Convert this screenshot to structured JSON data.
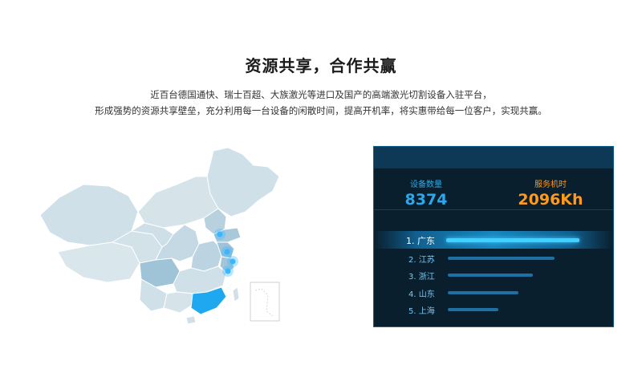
{
  "header": {
    "title": "资源共享，合作共赢",
    "desc_line1": "近百台德国通快、瑞士百超、大族激光等进口及国产的高端激光切割设备入驻平台，",
    "desc_line2": "形成强势的资源共享壁垒，充分利用每一台设备的闲散时间，提高开机率，将实惠带给每一位客户，实现共赢。"
  },
  "stats": {
    "devices_label": "设备数量",
    "devices_value": "8374",
    "hours_label": "服务机时",
    "hours_value": "2096Kh"
  },
  "ranking": [
    {
      "label": "1. 广东",
      "level": 1.0
    },
    {
      "label": "2. 江苏",
      "level": 0.8
    },
    {
      "label": "3. 浙江",
      "level": 0.64
    },
    {
      "label": "4. 山东",
      "level": 0.53
    },
    {
      "label": "5. 上海",
      "level": 0.38
    }
  ],
  "colors": {
    "highlight_region": "#1da8ef",
    "device_value": "#2aa8ea",
    "hours_value": "#ff9a1c",
    "panel_bg": "#0a1f2e"
  }
}
